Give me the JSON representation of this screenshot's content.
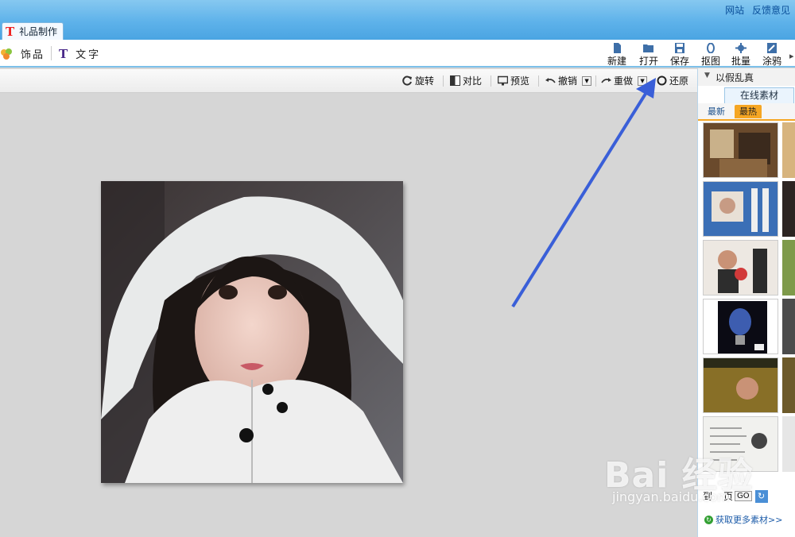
{
  "header": {
    "links": [
      "网站",
      "反馈意见"
    ],
    "tab_label": "礼品制作"
  },
  "toolbar": {
    "left_items": [
      {
        "label": "饰品",
        "icon": "ornament-icon"
      },
      {
        "label": "文字",
        "icon": "text-icon"
      }
    ],
    "buttons": [
      {
        "label": "新建",
        "icon": "new-file-icon"
      },
      {
        "label": "打开",
        "icon": "folder-open-icon"
      },
      {
        "label": "保存",
        "icon": "save-icon"
      },
      {
        "label": "抠图",
        "icon": "cutout-icon"
      },
      {
        "label": "批量",
        "icon": "batch-icon"
      },
      {
        "label": "涂鸦",
        "icon": "doodle-icon"
      }
    ]
  },
  "image_toolbar": {
    "rotate": "旋转",
    "compare": "对比",
    "preview": "预览",
    "undo": "撤销",
    "redo": "重做",
    "restore": "还原"
  },
  "right_panel": {
    "header": "以假乱真",
    "tab": "在线素材",
    "subtabs": [
      "最新",
      "最热"
    ],
    "active_subtab": "最热",
    "pager": {
      "prefix": "到",
      "middle": "页",
      "go": "GO"
    },
    "more_link": "获取更多素材>>"
  },
  "watermark": {
    "main": "Bai 经验",
    "sub": "jingyan.baidu.com"
  },
  "colors": {
    "header_blue": "#5eb2ea",
    "arrow": "#3a5fd8",
    "accent_orange": "#f5a623"
  }
}
